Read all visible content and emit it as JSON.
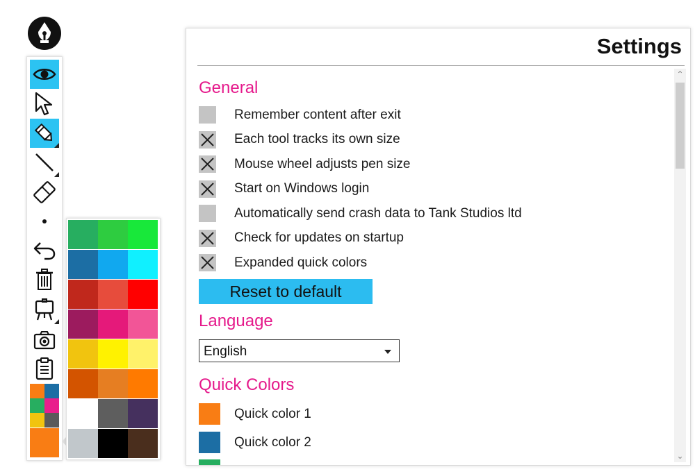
{
  "settings": {
    "title": "Settings",
    "sections": {
      "general": "General",
      "language": "Language",
      "quick_colors": "Quick Colors"
    },
    "options": [
      {
        "label": "Remember content after exit",
        "checked": false
      },
      {
        "label": "Each tool tracks its own size",
        "checked": true
      },
      {
        "label": "Mouse wheel adjusts pen size",
        "checked": true
      },
      {
        "label": "Start on Windows login",
        "checked": true
      },
      {
        "label": "Automatically send crash data to Tank Studios ltd",
        "checked": false
      },
      {
        "label": "Check for updates on startup",
        "checked": true
      },
      {
        "label": "Expanded quick colors",
        "checked": true
      }
    ],
    "reset_label": "Reset to default",
    "language_value": "English",
    "quick_colors": [
      {
        "label": "Quick color 1",
        "color": "#f97d14"
      },
      {
        "label": "Quick color 2",
        "color": "#1c6ea4"
      },
      {
        "label": "",
        "color": "#27ae60"
      }
    ]
  },
  "toolbar": {
    "tools": [
      "eye-icon",
      "pointer-icon",
      "pen-icon",
      "line-icon",
      "eraser-icon",
      "dot-icon",
      "undo-icon",
      "trash-icon",
      "canvas-icon",
      "camera-icon",
      "clipboard-icon"
    ],
    "active_tools": [
      "eye-icon",
      "pen-icon"
    ],
    "quick_color_grid": [
      "#f97d14",
      "#1c6ea4",
      "#27ae60",
      "#e91e8c",
      "#f1c40f",
      "#5a5a5a"
    ],
    "current_color": "#f97d14"
  },
  "palette": {
    "colors": [
      [
        "#27ae60",
        "#2ecc40",
        "#18e83a"
      ],
      [
        "#1c6ea4",
        "#11a8ef",
        "#10f0ff"
      ],
      [
        "#c0281c",
        "#e74c3c",
        "#ff0000"
      ],
      [
        "#9c1b5e",
        "#e5197a",
        "#f25597"
      ],
      [
        "#f1c40f",
        "#fff200",
        "#fff26a"
      ],
      [
        "#d35400",
        "#e67e22",
        "#ff7a00"
      ],
      [
        "#ffffff",
        "#5e5e5e",
        "#45305e"
      ],
      [
        "#c1c7cb",
        "#000000",
        "#4a2e1d"
      ]
    ]
  }
}
